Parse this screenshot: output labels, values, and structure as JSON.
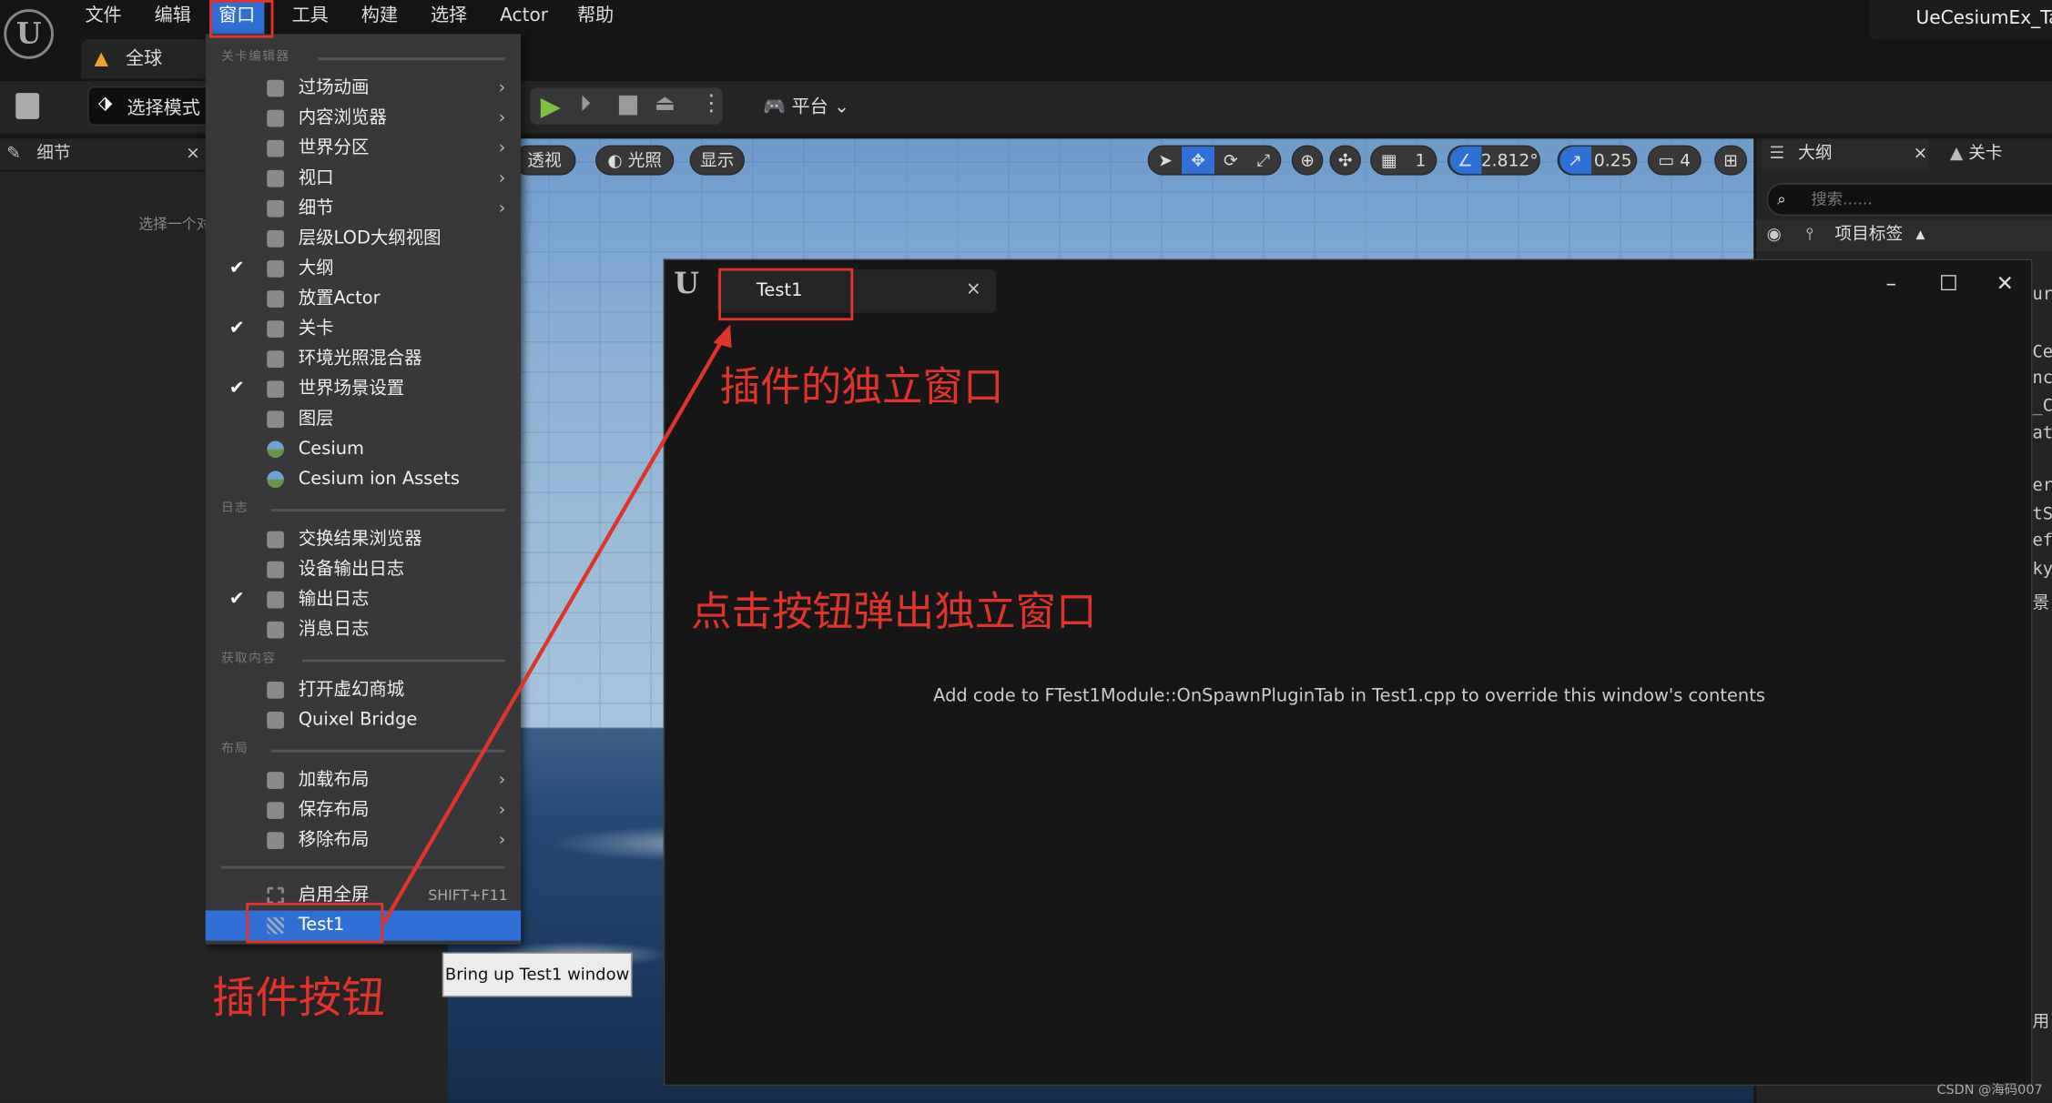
{
  "menubar": {
    "items": [
      "文件",
      "编辑",
      "窗口",
      "工具",
      "构建",
      "选择",
      "Actor",
      "帮助"
    ],
    "active": "窗口"
  },
  "window_title": "UeCesiumEx_Tai",
  "level_tab": "全球",
  "toolbar": {
    "select_mode": "选择模式",
    "platform": "平台"
  },
  "details_panel": {
    "title": "细节",
    "close": "×",
    "hint": "选择一个对"
  },
  "viewport": {
    "perspective": "透视",
    "lighting": "光照",
    "show": "显示",
    "grid_snap": "1",
    "angle_snap": "2.812°",
    "scale_snap": "0.25",
    "camera_speed": "4"
  },
  "outliner": {
    "tab": "大纲",
    "close": "×",
    "level_tab": "关卡",
    "search_placeholder": "搜索......",
    "column": "项目标签",
    "partial_rows": [
      "ur",
      "Ce",
      "nc",
      "_C",
      "ate",
      "era",
      "tS",
      "efa",
      "ky",
      "景",
      "用"
    ]
  },
  "window_menu": {
    "sections": [
      {
        "header": "关卡编辑器",
        "items": [
          {
            "label": "过场动画",
            "submenu": true,
            "icon": "clapper-icon"
          },
          {
            "label": "内容浏览器",
            "submenu": true,
            "icon": "folder-search-icon"
          },
          {
            "label": "世界分区",
            "submenu": true,
            "icon": "world-partition-icon"
          },
          {
            "label": "视口",
            "submenu": true,
            "icon": "viewport-grid-icon"
          },
          {
            "label": "细节",
            "submenu": true,
            "icon": "details-pencil-icon"
          },
          {
            "label": "层级LOD大纲视图",
            "icon": "hlod-icon"
          },
          {
            "label": "大纲",
            "checked": true,
            "icon": "outliner-icon"
          },
          {
            "label": "放置Actor",
            "icon": "place-actor-icon"
          },
          {
            "label": "关卡",
            "checked": true,
            "icon": "levels-icon"
          },
          {
            "label": "环境光照混合器",
            "icon": "env-light-mixer-icon"
          },
          {
            "label": "世界场景设置",
            "checked": true,
            "icon": "world-settings-icon"
          },
          {
            "label": "图层",
            "icon": "layers-icon"
          },
          {
            "label": "Cesium",
            "icon": "cesium-icon"
          },
          {
            "label": "Cesium ion Assets",
            "icon": "cesium-icon"
          }
        ]
      },
      {
        "header": "日志",
        "items": [
          {
            "label": "交换结果浏览器",
            "icon": "result-browser-icon"
          },
          {
            "label": "设备输出日志",
            "icon": "device-log-icon"
          },
          {
            "label": "输出日志",
            "checked": true,
            "icon": "output-log-icon"
          },
          {
            "label": "消息日志",
            "icon": "message-log-icon"
          }
        ]
      },
      {
        "header": "获取内容",
        "items": [
          {
            "label": "打开虚幻商城",
            "icon": "marketplace-icon"
          },
          {
            "label": "Quixel Bridge",
            "icon": "bridge-icon"
          }
        ]
      },
      {
        "header": "布局",
        "items": [
          {
            "label": "加载布局",
            "submenu": true,
            "icon": "load-layout-icon"
          },
          {
            "label": "保存布局",
            "submenu": true,
            "icon": "save-layout-icon"
          },
          {
            "label": "移除布局",
            "submenu": true,
            "icon": "remove-layout-icon"
          }
        ]
      },
      {
        "header": "",
        "items": [
          {
            "label": "启用全屏",
            "shortcut": "SHIFT+F11",
            "icon": "fullscreen-icon"
          },
          {
            "label": "Test1",
            "highlighted": true,
            "icon": "plugin-icon"
          }
        ]
      }
    ]
  },
  "tooltip": "Bring up Test1 window",
  "plugin_window": {
    "tab": "Test1",
    "close": "×",
    "content": "Add code to FTest1Module::OnSpawnPluginTab in Test1.cpp to override this window's contents",
    "minimize": "–",
    "maximize": "☐",
    "close_window": "✕"
  },
  "annotations": {
    "window_label": "插件的独立窗口",
    "click_label": "点击按钮弹出独立窗口",
    "button_label": "插件按钮",
    "color": "#e0332b"
  },
  "watermark": "CSDN @海码007",
  "colors": {
    "accent": "#2f6fd6",
    "menu_bg": "#38383a",
    "panel_bg": "#242424",
    "play_green": "#7cc242"
  }
}
